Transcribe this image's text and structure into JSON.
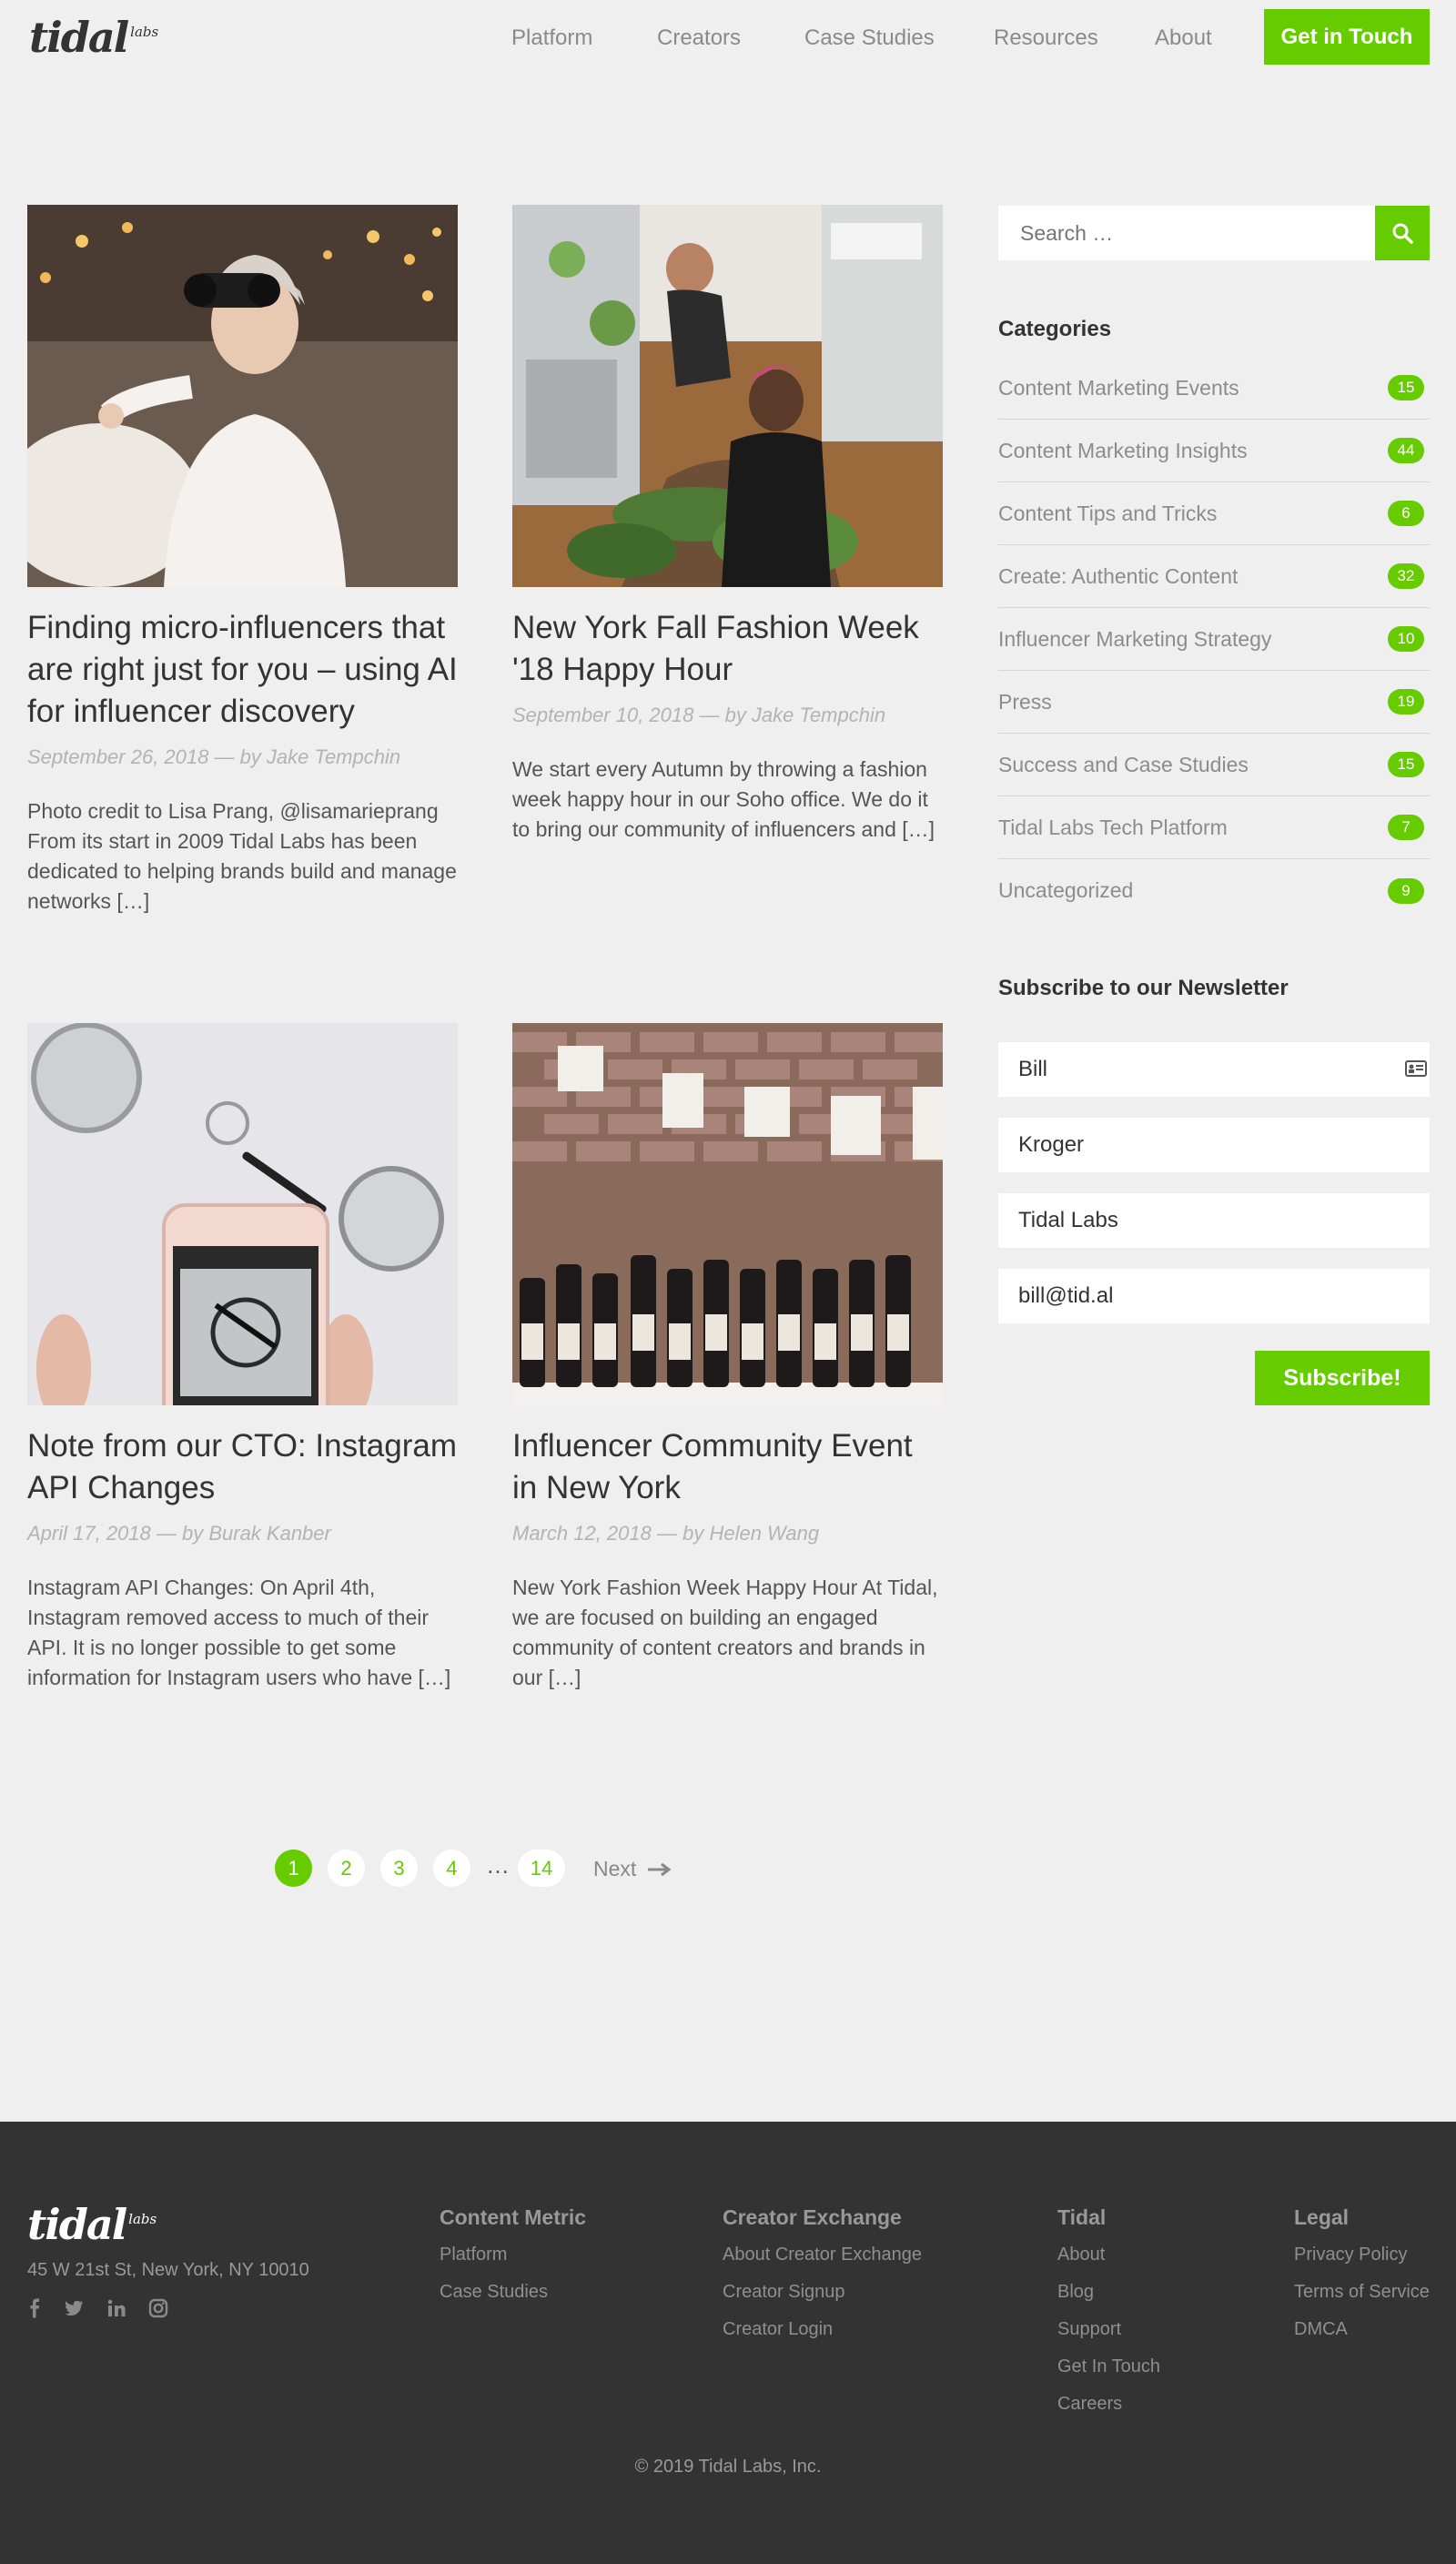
{
  "brand": {
    "logo_main": "tidal",
    "logo_sub": "labs",
    "accent": "#66cc00"
  },
  "nav": {
    "items": [
      "Platform",
      "Creators",
      "Case Studies",
      "Resources",
      "About"
    ],
    "cta": "Get in Touch"
  },
  "posts": [
    {
      "title": "Finding micro-influencers that are right just for you – using AI for influencer discovery",
      "meta": "September 26, 2018 — by Jake Tempchin",
      "excerpt": "Photo credit to Lisa Prang, @lisamarieprang From its start in 2009 Tidal Labs has been dedicated to helping brands build and manage networks […]",
      "image": "woman-with-binoculars"
    },
    {
      "title": "New York Fall Fashion Week '18 Happy Hour",
      "meta": "September 10, 2018 — by Jake Tempchin",
      "excerpt": "We start every Autumn by throwing a fashion week happy hour in our Soho office. We do it to bring our community of influencers and […]",
      "image": "women-arranging-flowers"
    },
    {
      "title": "Note from our CTO: Instagram API Changes",
      "meta": "April 17, 2018 — by Burak Kanber",
      "excerpt": "Instagram API Changes: On April 4th, Instagram removed access to much of their API. It is no longer possible to get some information for Instagram users who have […]",
      "image": "phone-photographing-glasses"
    },
    {
      "title": "Influencer Community Event in New York",
      "meta": "March 12, 2018 — by Helen Wang",
      "excerpt": "New York Fashion Week Happy Hour At Tidal, we are focused on building an engaged community of content creators and brands in our […]",
      "image": "wine-bottles-brick-wall"
    }
  ],
  "sidebar": {
    "search_placeholder": "Search …",
    "categories_title": "Categories",
    "categories": [
      {
        "label": "Content Marketing Events",
        "count": "15"
      },
      {
        "label": "Content Marketing Insights",
        "count": "44"
      },
      {
        "label": "Content Tips and Tricks",
        "count": "6"
      },
      {
        "label": "Create: Authentic Content",
        "count": "32"
      },
      {
        "label": "Influencer Marketing Strategy",
        "count": "10"
      },
      {
        "label": "Press",
        "count": "19"
      },
      {
        "label": "Success and Case Studies",
        "count": "15"
      },
      {
        "label": "Tidal Labs Tech Platform",
        "count": "7"
      },
      {
        "label": "Uncategorized",
        "count": "9"
      }
    ],
    "newsletter_title": "Subscribe to our Newsletter",
    "fields": [
      "Bill",
      "Kroger",
      "Tidal Labs",
      "bill@tid.al"
    ],
    "subscribe": "Subscribe!"
  },
  "pagination": {
    "pages": [
      "1",
      "2",
      "3",
      "4"
    ],
    "ellipsis": "…",
    "last": "14",
    "next": "Next"
  },
  "footer": {
    "logo_main": "tidal",
    "logo_sub": "labs",
    "address": "45 W 21st St, New York, NY 10010",
    "social": [
      "facebook-icon",
      "twitter-icon",
      "linkedin-icon",
      "instagram-icon"
    ],
    "columns": [
      {
        "title": "Content Metric",
        "links": [
          "Platform",
          "Case Studies"
        ]
      },
      {
        "title": "Creator Exchange",
        "links": [
          "About Creator Exchange",
          "Creator Signup",
          "Creator Login"
        ]
      },
      {
        "title": "Tidal",
        "links": [
          "About",
          "Blog",
          "Support",
          "Get In Touch",
          "Careers"
        ]
      },
      {
        "title": "Legal",
        "links": [
          "Privacy Policy",
          "Terms of Service",
          "DMCA"
        ]
      }
    ],
    "copyright": "© 2019 Tidal Labs, Inc."
  }
}
